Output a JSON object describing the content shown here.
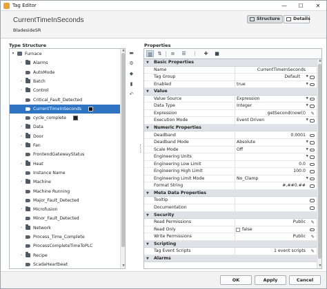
{
  "window": {
    "title": "Tag Editor",
    "controls": {
      "minimize": "—",
      "maximize": "☐",
      "close": "✕"
    }
  },
  "header": {
    "tag_name": "CurrentTimeInSeconds",
    "provider": "BladesideSR",
    "tabs": [
      {
        "label": "Structure",
        "icon": "structure-icon",
        "active": true
      },
      {
        "label": "Details",
        "icon": "details-icon",
        "active": false
      }
    ]
  },
  "tree": {
    "heading": "Type Structure",
    "items": [
      {
        "label": "Furnace",
        "icon": "udt",
        "indent": 0,
        "arrow": "▾"
      },
      {
        "label": "Alarms",
        "icon": "folder",
        "indent": 1,
        "arrow": "›"
      },
      {
        "label": "AutoMode",
        "icon": "tag",
        "indent": 1,
        "arrow": ""
      },
      {
        "label": "Batch",
        "icon": "folder",
        "indent": 1,
        "arrow": "›"
      },
      {
        "label": "Control",
        "icon": "folder",
        "indent": 1,
        "arrow": "›"
      },
      {
        "label": "Critical_Fault_Detected",
        "icon": "tag",
        "indent": 1,
        "arrow": ""
      },
      {
        "label": "CurrentTimeInSeconds",
        "icon": "tag",
        "indent": 1,
        "arrow": "",
        "selected": true,
        "binding": true
      },
      {
        "label": "cycle_complete",
        "icon": "tag",
        "indent": 1,
        "arrow": "",
        "binding": true
      },
      {
        "label": "Data",
        "icon": "folder",
        "indent": 1,
        "arrow": "›"
      },
      {
        "label": "Door",
        "icon": "folder",
        "indent": 1,
        "arrow": "›"
      },
      {
        "label": "Fan",
        "icon": "folder",
        "indent": 1,
        "arrow": "›"
      },
      {
        "label": "FrontendGatewayStatus",
        "icon": "tag",
        "indent": 1,
        "arrow": ""
      },
      {
        "label": "Heat",
        "icon": "folder",
        "indent": 1,
        "arrow": "›"
      },
      {
        "label": "Instance Name",
        "icon": "tag",
        "indent": 1,
        "arrow": ""
      },
      {
        "label": "Machine",
        "icon": "folder",
        "indent": 1,
        "arrow": "›"
      },
      {
        "label": "Machine Running",
        "icon": "tag",
        "indent": 1,
        "arrow": ""
      },
      {
        "label": "Major_Fault_Detected",
        "icon": "tag",
        "indent": 1,
        "arrow": ""
      },
      {
        "label": "Microfusion",
        "icon": "folder",
        "indent": 1,
        "arrow": "›"
      },
      {
        "label": "Minor_Fault_Detected",
        "icon": "tag",
        "indent": 1,
        "arrow": ""
      },
      {
        "label": "Network",
        "icon": "folder",
        "indent": 1,
        "arrow": "›"
      },
      {
        "label": "Process_Time_Complete",
        "icon": "tag",
        "indent": 1,
        "arrow": ""
      },
      {
        "label": "ProcessCompleteTimeToPLC",
        "icon": "tag",
        "indent": 1,
        "arrow": ""
      },
      {
        "label": "Recipe",
        "icon": "folder",
        "indent": 1,
        "arrow": "›"
      },
      {
        "label": "ScadaHeartbeat",
        "icon": "tag",
        "indent": 1,
        "arrow": ""
      }
    ]
  },
  "tree_toolbar": [
    "folder-add-icon",
    "udt-add-icon",
    "tag-add-icon",
    "delete-icon",
    "undo-icon"
  ],
  "properties": {
    "heading": "Properties",
    "toolbar": [
      "categorized-icon",
      "sort-icon",
      "collapse-icon",
      "expand-icon",
      "filter-icon",
      "add-icon",
      "delete-icon"
    ],
    "rows": [
      {
        "type": "cat",
        "label": "Basic Properties"
      },
      {
        "type": "prop",
        "name": "Name",
        "value": "CurrentTimeInSeconds",
        "align": "right",
        "trail": "none"
      },
      {
        "type": "prop",
        "name": "Tag Group",
        "value": "Default",
        "align": "right",
        "trail": "dropdown-link"
      },
      {
        "type": "prop",
        "name": "Enabled",
        "value": "true",
        "align": "left",
        "trail": "dropdown-link"
      },
      {
        "type": "cat",
        "label": "Value"
      },
      {
        "type": "prop",
        "name": "Value Source",
        "value": "Expression",
        "align": "left",
        "trail": "dropdown-link"
      },
      {
        "type": "prop",
        "name": "Data Type",
        "value": "Integer",
        "align": "left",
        "trail": "dropdown-link"
      },
      {
        "type": "prop",
        "name": "Expression",
        "value": "getSecond(now())",
        "align": "right",
        "trail": "edit"
      },
      {
        "type": "prop",
        "name": "Execution Mode",
        "value": "Event Driven",
        "align": "left",
        "trail": "dropdown-link"
      },
      {
        "type": "cat",
        "label": "Numeric Properties"
      },
      {
        "type": "prop",
        "name": "Deadband",
        "value": "0.0001",
        "align": "right",
        "trail": "link"
      },
      {
        "type": "prop",
        "name": "Deadband Mode",
        "value": "Absolute",
        "align": "left",
        "trail": "dropdown-link"
      },
      {
        "type": "prop",
        "name": "Scale Mode",
        "value": "Off",
        "align": "left",
        "trail": "dropdown-link"
      },
      {
        "type": "prop",
        "name": "Engineering Units",
        "value": "",
        "align": "left",
        "trail": "dropdown-link"
      },
      {
        "type": "prop",
        "name": "Engineering Low Limit",
        "value": "0.0",
        "align": "right",
        "trail": "link"
      },
      {
        "type": "prop",
        "name": "Engineering High Limit",
        "value": "100.0",
        "align": "right",
        "trail": "link"
      },
      {
        "type": "prop",
        "name": "Engineering Limit Mode",
        "value": "No_Clamp",
        "align": "left",
        "trail": "dropdown-link"
      },
      {
        "type": "prop",
        "name": "Format String",
        "value": "#,##0.##",
        "align": "right",
        "trail": "link"
      },
      {
        "type": "cat",
        "label": "Meta Data Properties"
      },
      {
        "type": "prop",
        "name": "Tooltip",
        "value": "",
        "align": "right",
        "trail": "link"
      },
      {
        "type": "prop",
        "name": "Documentation",
        "value": "",
        "align": "right",
        "trail": "link"
      },
      {
        "type": "cat",
        "label": "Security"
      },
      {
        "type": "prop",
        "name": "Read Permissions",
        "value": "Public",
        "align": "right",
        "trail": "edit"
      },
      {
        "type": "prop",
        "name": "Read Only",
        "value": "false",
        "align": "check",
        "trail": "link"
      },
      {
        "type": "prop",
        "name": "Write Permissions",
        "value": "Public",
        "align": "right",
        "trail": "edit"
      },
      {
        "type": "cat",
        "label": "Scripting"
      },
      {
        "type": "prop",
        "name": "Tag Event Scripts",
        "value": "1 event scripts",
        "align": "right",
        "trail": "edit"
      },
      {
        "type": "cat",
        "label": "Alarms"
      }
    ]
  },
  "footer": {
    "ok": "OK",
    "apply": "Apply",
    "cancel": "Cancel"
  }
}
